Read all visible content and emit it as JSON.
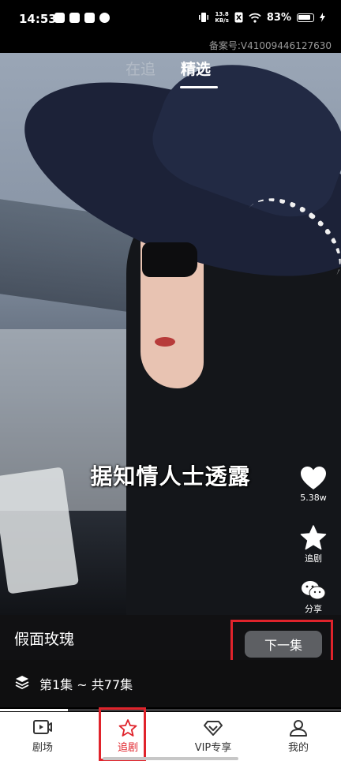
{
  "status_bar": {
    "time": "14:53",
    "net_speed_value": "13.8",
    "net_speed_unit": "KB/s",
    "battery": "83%"
  },
  "filing_number": "备案号:V41009446127630",
  "top_tabs": [
    {
      "label": "在追",
      "active": false
    },
    {
      "label": "精选",
      "active": true
    }
  ],
  "video": {
    "subtitle": "据知情人士透露"
  },
  "actions": {
    "like_count": "5.38w",
    "follow_label": "追剧",
    "share_label": "分享"
  },
  "drama": {
    "title": "假面玫瑰",
    "next_button": "下一集",
    "episode_info": "第1集 ~ 共77集",
    "progress": 0.2
  },
  "bottom_nav": [
    {
      "label": "剧场",
      "icon": "play-box-icon",
      "active": false
    },
    {
      "label": "追剧",
      "icon": "star-outline-icon",
      "active": true
    },
    {
      "label": "VIP专享",
      "icon": "diamond-icon",
      "active": false
    },
    {
      "label": "我的",
      "icon": "person-icon",
      "active": false
    }
  ],
  "colors": {
    "accent": "#e0232b",
    "button_bg": "#5d5f63"
  }
}
